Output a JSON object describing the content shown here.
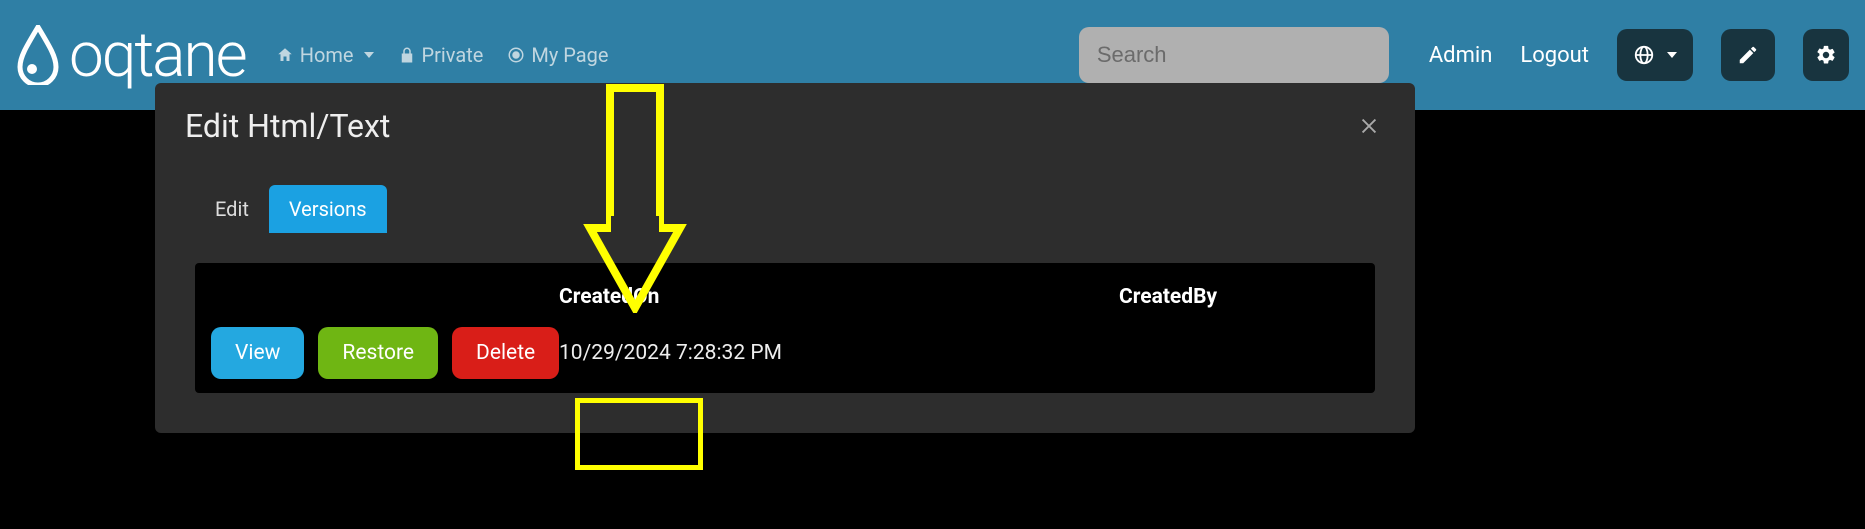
{
  "brand": "oqtane",
  "nav": {
    "home": "Home",
    "private": "Private",
    "mypage": "My Page"
  },
  "search": {
    "placeholder": "Search"
  },
  "right": {
    "admin": "Admin",
    "logout": "Logout"
  },
  "modal": {
    "title": "Edit Html/Text",
    "tabs": {
      "edit": "Edit",
      "versions": "Versions"
    },
    "headers": {
      "created_on": "CreatedOn",
      "created_by": "CreatedBy"
    },
    "buttons": {
      "view": "View",
      "restore": "Restore",
      "delete": "Delete"
    },
    "row": {
      "created_on": "10/29/2024 7:28:32 PM",
      "created_by": ""
    }
  }
}
